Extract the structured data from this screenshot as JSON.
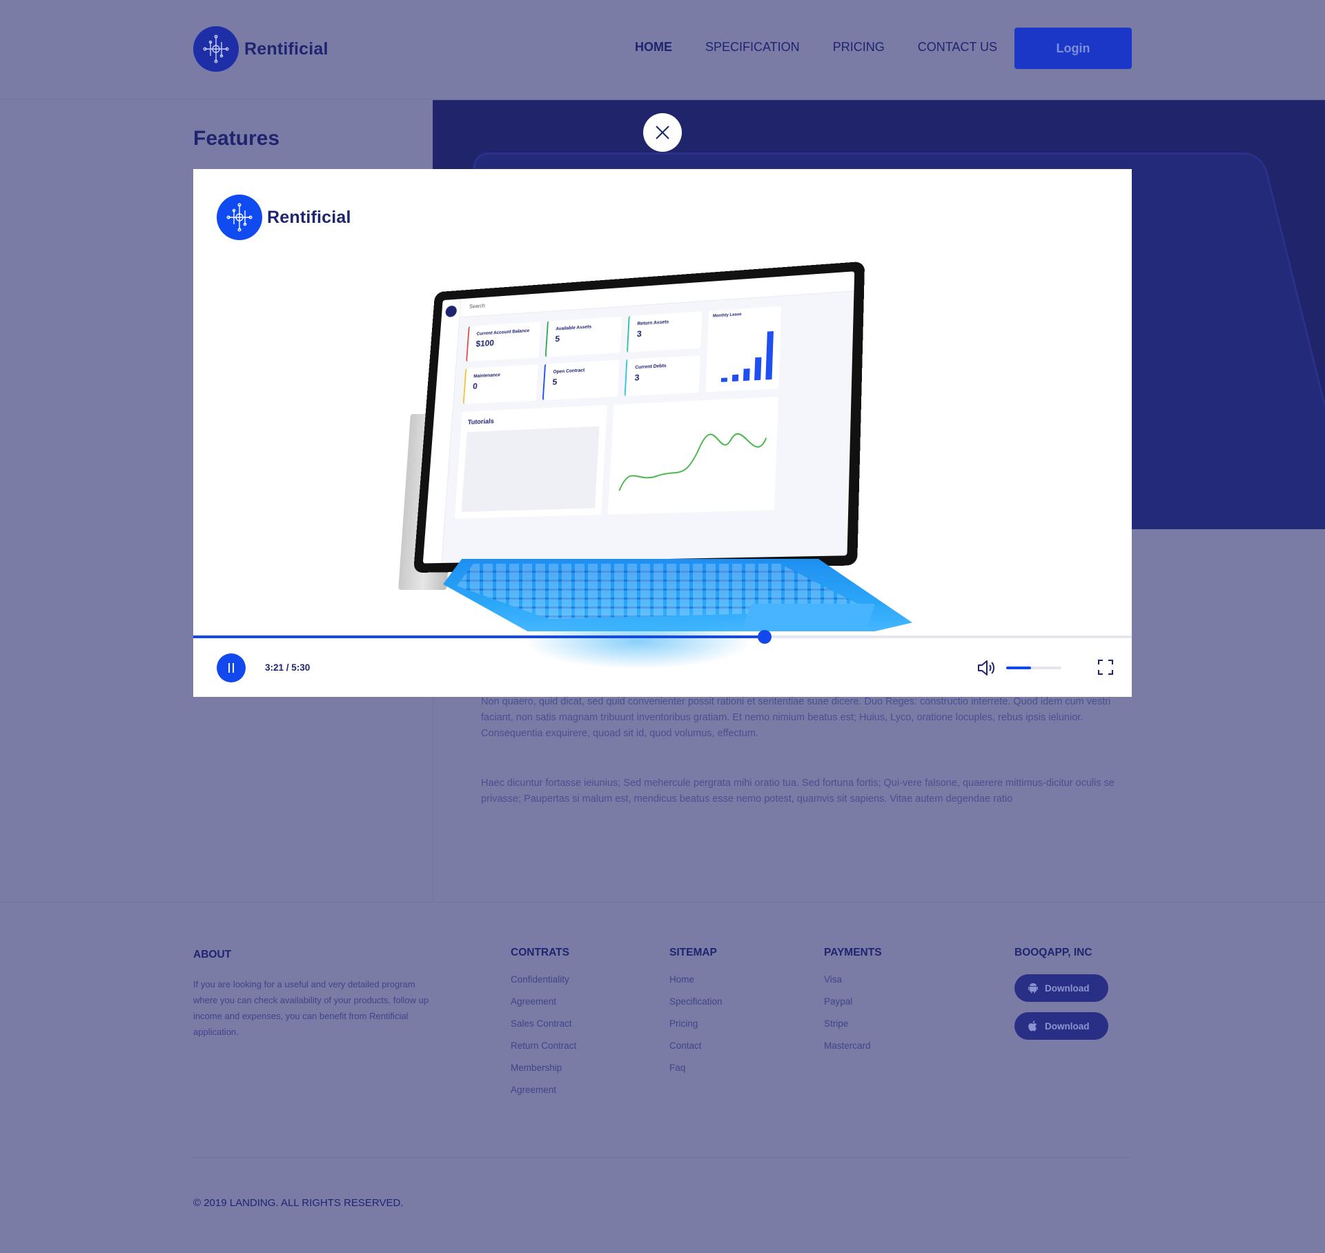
{
  "header": {
    "brand": "Rentificial",
    "nav": [
      "HOME",
      "SPECIFICATION",
      "PRICING",
      "CONTACT US"
    ],
    "active_nav": "HOME",
    "login_label": "Login"
  },
  "page": {
    "features_title": "Features",
    "paragraph_1": "Non quaero, quid dicat, sed quid convenienter possit rationi et sententiae suae dicere. Duo Reges: constructio interrete. Quod idem cum vestri faciant, non satis magnam tribuunt inventoribus gratiam. Et nemo nimium beatus est; Huius, Lyco, oratione locuples, rebus ipsis ielunior. Consequentia exquirere, quoad sit id, quod volumus, effectum.",
    "paragraph_2": "Haec dicuntur fortasse ieiunius; Sed mehercule pergrata mihi oratio tua. Sed fortuna fortis; Qui-vere falsone, quaerere mittimus-dicitur oculis se privasse; Paupertas si malum est, mendicus beatus esse nemo potest, quamvis sit sapiens. Vitae autem degendae ratio"
  },
  "modal": {
    "brand": "Rentificial",
    "player": {
      "current_time": "3:21",
      "duration": "5:30",
      "time_label": "3:21 / 5:30",
      "progress_fraction": 0.609,
      "volume_fraction": 0.45,
      "state": "playing"
    },
    "screen": {
      "search_placeholder": "Search",
      "cards": [
        {
          "label": "Current Account Balance",
          "value": "$100",
          "color": "#e24b4b"
        },
        {
          "label": "Available Assets",
          "value": "5",
          "color": "#2fa84f"
        },
        {
          "label": "Return Assets",
          "value": "3",
          "color": "#2fc3a0"
        },
        {
          "label": "Maintenance",
          "value": "0",
          "color": "#f2c530"
        },
        {
          "label": "Open Contract",
          "value": "5",
          "color": "#1e4ff0"
        },
        {
          "label": "Current Debts",
          "value": "3",
          "color": "#36c6e0"
        }
      ],
      "chart_title": "Monthly Lease",
      "tutorials_title": "Tutorials"
    }
  },
  "footer": {
    "about": {
      "title": "ABOUT",
      "text": "If you are looking for a useful and very detailed program where you can check availability of your products, follow up income and expenses, you can benefit from Rentificial application."
    },
    "contrats": {
      "title": "CONTRATS",
      "links": [
        "Confidentiality",
        "Agreement",
        "Sales Contract",
        "Return Contract",
        "Membership",
        "Agreement"
      ]
    },
    "sitemap": {
      "title": "SITEMAP",
      "links": [
        "Home",
        "Specification",
        "Pricing",
        "Contact",
        "Faq"
      ]
    },
    "payments": {
      "title": "PAYMENTS",
      "links": [
        "Visa",
        "Paypal",
        "Stripe",
        "Mastercard"
      ]
    },
    "company": {
      "title": "BOOQAPP, INC",
      "android_label": "Download",
      "ios_label": "Download"
    },
    "copyright": "© 2019 LANDING. ALL RIGHTS RESERVED."
  },
  "colors": {
    "overlay_bg": "#7a7ca6",
    "brand_navy": "#1e2470",
    "accent_blue": "#1348ee",
    "hero_panel": "#1f246b"
  },
  "icons": [
    "logo-network-icon",
    "close-icon",
    "pause-icon",
    "volume-icon",
    "fullscreen-icon",
    "android-icon",
    "apple-icon"
  ]
}
